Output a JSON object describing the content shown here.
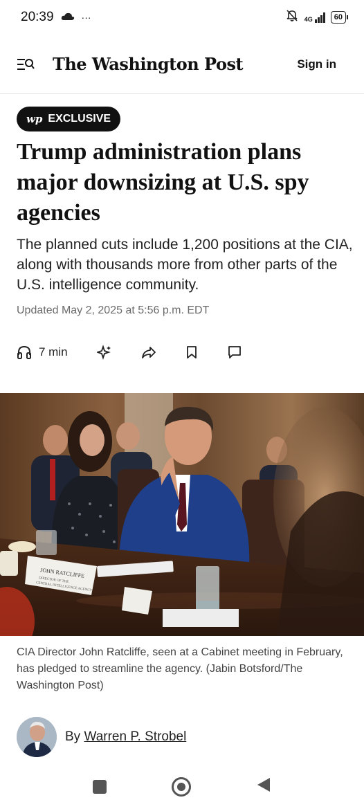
{
  "status_bar": {
    "time": "20:39",
    "more": "···",
    "network": "4G",
    "battery": "60"
  },
  "header": {
    "logo": "The Washington Post",
    "sign_in": "Sign in"
  },
  "article": {
    "badge_mark": "wp",
    "badge_label": "EXCLUSIVE",
    "headline": "Trump administration plans major downsizing at U.S. spy agencies",
    "subhead": "The planned cuts include 1,200 positions at the CIA, along with thousands more from other parts of the U.S. intelligence community.",
    "updated": "Updated May 2, 2025 at 5:56 p.m. EDT",
    "listen_time": "7 min",
    "caption": "CIA Director John Ratcliffe, seen at a Cabinet meeting in February, has pledged to streamline the agency. (Jabin Botsford/The Washington Post)",
    "byline_prefix": "By",
    "author": "Warren P. Strobel"
  },
  "photo": {
    "nameplate_line1": "JOHN RATCLIFFE",
    "nameplate_line2": "DIRECTOR OF THE",
    "nameplate_line3": "CENTRAL INTELLIGENCE AGENCY"
  },
  "icons": {
    "menu": "menu-search-icon",
    "listen": "headphones-icon",
    "ai": "sparkle-icon",
    "share": "share-icon",
    "save": "bookmark-icon",
    "comments": "comment-icon"
  },
  "colors": {
    "badge_bg": "#111111",
    "text": "#111111",
    "meta": "#6b6b6b"
  }
}
